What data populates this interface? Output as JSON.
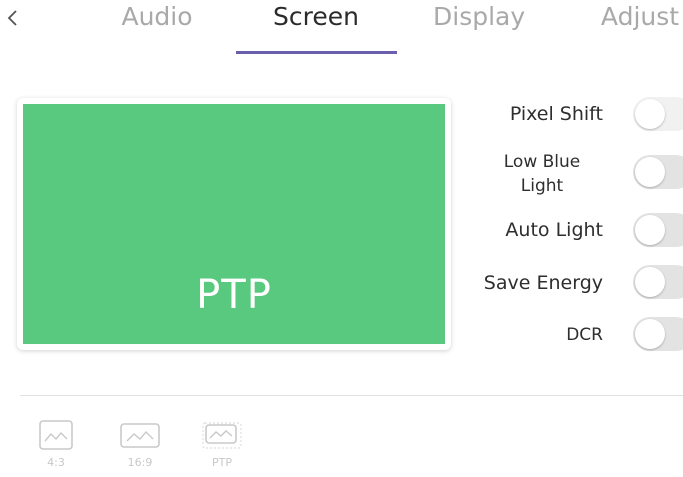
{
  "nav": {
    "back_icon": "chevron-left-icon",
    "tabs": [
      {
        "label": "Audio",
        "active": false
      },
      {
        "label": "Screen",
        "active": true
      },
      {
        "label": "Display",
        "active": false
      },
      {
        "label": "Adjust",
        "active": false
      }
    ],
    "accent_color": "#6a5fae"
  },
  "preview": {
    "label": "PTP",
    "screen_color": "#58c97e"
  },
  "settings": [
    {
      "label": "Pixel Shift",
      "enabled": false
    },
    {
      "label": "Low Blue Light",
      "enabled": false
    },
    {
      "label": "Auto Light",
      "enabled": false
    },
    {
      "label": "Save Energy",
      "enabled": false
    },
    {
      "label": "DCR",
      "enabled": false
    }
  ],
  "ratios": [
    {
      "label": "4:3",
      "icon": "aspect-4-3-icon"
    },
    {
      "label": "16:9",
      "icon": "aspect-16-9-icon"
    },
    {
      "label": "PTP",
      "icon": "aspect-ptp-icon"
    }
  ]
}
